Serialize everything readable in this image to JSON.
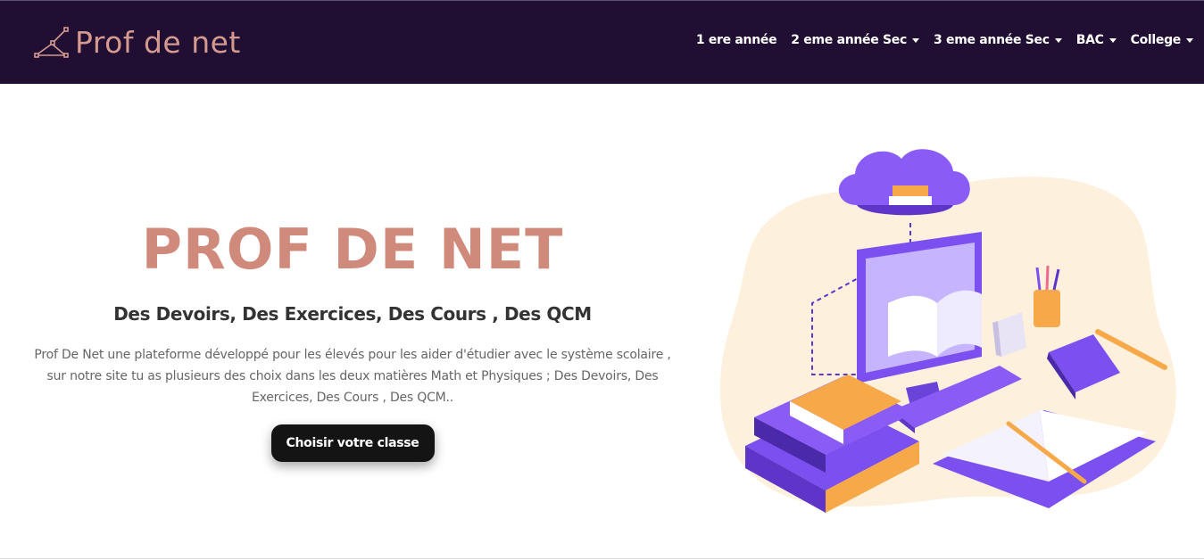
{
  "brand": {
    "name": "Prof de net",
    "logo_icon": "network-logo-icon"
  },
  "nav": {
    "items": [
      {
        "label": "1 ere année",
        "dropdown": false
      },
      {
        "label": "2 eme année Sec",
        "dropdown": true
      },
      {
        "label": "3 eme année Sec",
        "dropdown": true
      },
      {
        "label": "BAC",
        "dropdown": true
      },
      {
        "label": "College",
        "dropdown": true
      }
    ]
  },
  "hero": {
    "title": "PROF DE NET",
    "subtitle": "Des Devoirs, Des Exercices, Des Cours , Des QCM",
    "description": "Prof De Net une plateforme développé pour les élevés pour les aider d'étudier avec le système scolaire , sur notre site tu as plusieurs des choix dans les deux matières Math et Physiques ; Des Devoirs, Des Exercices, Des Cours , Des QCM..",
    "cta_label": "Choisir votre classe"
  },
  "colors": {
    "navbar_bg": "#200e33",
    "brand": "#d59a8f",
    "hero_title": "#d08a7b",
    "button_bg": "#141414",
    "accent_purple": "#7b4ff0",
    "accent_orange": "#f7a94a"
  }
}
